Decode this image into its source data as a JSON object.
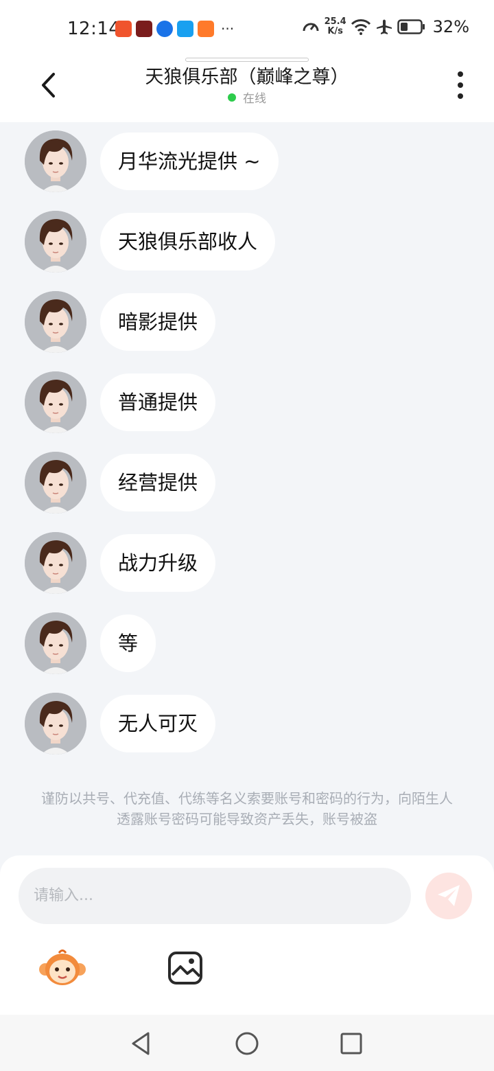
{
  "status_bar": {
    "time": "12:14",
    "net_speed_value": "25.4",
    "net_speed_unit": "K/s",
    "battery": "32%",
    "more_dots": "···"
  },
  "header": {
    "title": "天狼俱乐部（巅峰之尊）",
    "status": "在线"
  },
  "messages": [
    {
      "text": "月华流光提供 ~"
    },
    {
      "text": "天狼俱乐部收人"
    },
    {
      "text": "暗影提供"
    },
    {
      "text": "普通提供"
    },
    {
      "text": "经营提供"
    },
    {
      "text": "战力升级"
    },
    {
      "text": "等"
    },
    {
      "text": "无人可灭"
    }
  ],
  "notice": "谨防以共号、代充值、代练等名义索要账号和密码的行为，向陌生人透露账号密码可能导致资产丢失，账号被盗",
  "input": {
    "placeholder": "请输入..."
  },
  "colors": {
    "background": "#f3f5f8",
    "bubble": "#ffffff",
    "online": "#2dcc4c",
    "send": "#f27266"
  }
}
